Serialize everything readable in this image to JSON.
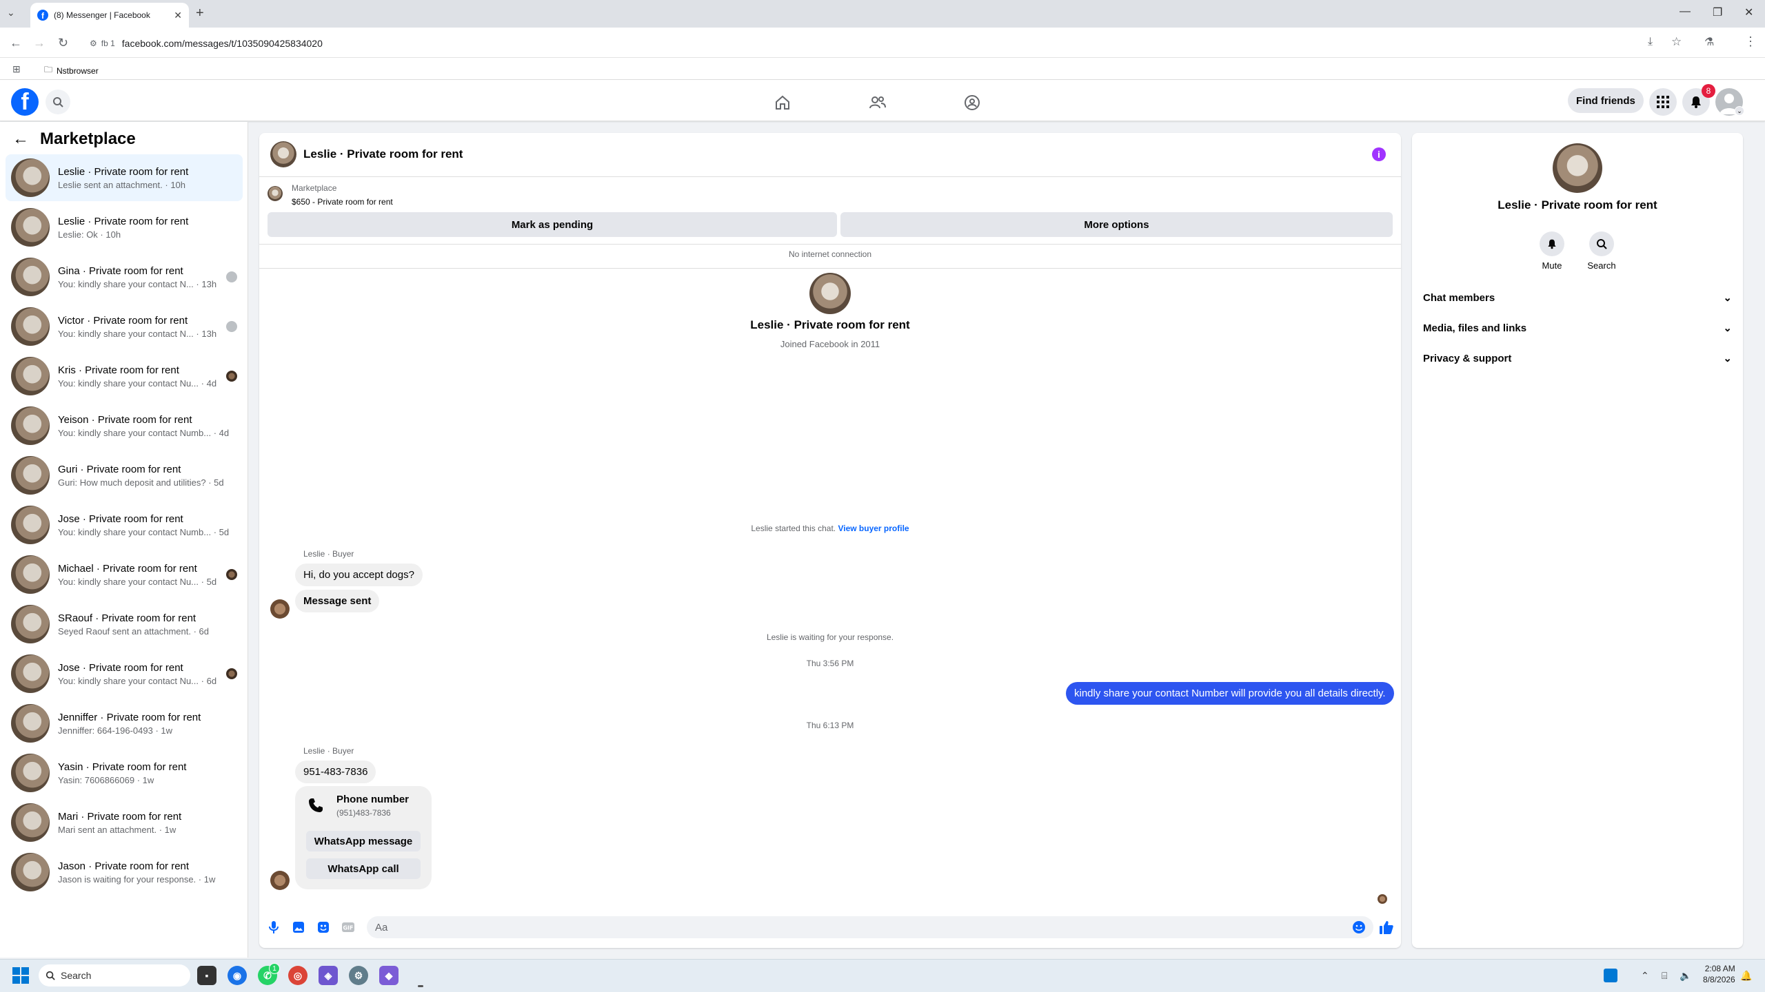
{
  "browser": {
    "tab_title": "(8) Messenger | Facebook",
    "url": "facebook.com/messages/t/1035090425834020",
    "site_chip": "fb 1",
    "bookmark_folder": "Nstbrowser"
  },
  "fb_header": {
    "find_friends": "Find friends",
    "notif_count": "8"
  },
  "sidebar": {
    "title": "Marketplace",
    "conversations": [
      {
        "name": "Leslie · Private room for rent",
        "preview": "Leslie sent an attachment. · 10h",
        "time": ""
      },
      {
        "name": "Leslie · Private room for rent",
        "preview": "Leslie: Ok · 10h",
        "time": ""
      },
      {
        "name": "Gina · Private room for rent",
        "preview": "You: kindly share your contact N...",
        "time": "· 13h"
      },
      {
        "name": "Victor · Private room for rent",
        "preview": "You: kindly share your contact N...",
        "time": "· 13h"
      },
      {
        "name": "Kris · Private room for rent",
        "preview": "You: kindly share your contact Nu...",
        "time": "· 4d"
      },
      {
        "name": "Yeison · Private room for rent",
        "preview": "You: kindly share your contact Numb...",
        "time": "· 4d"
      },
      {
        "name": "Guri · Private room for rent",
        "preview": "Guri: How much deposit and utilities?",
        "time": "· 5d"
      },
      {
        "name": "Jose · Private room for rent",
        "preview": "You: kindly share your contact Numb...",
        "time": "· 5d"
      },
      {
        "name": "Michael · Private room for rent",
        "preview": "You: kindly share your contact Nu...",
        "time": "· 5d"
      },
      {
        "name": "SRaouf · Private room for rent",
        "preview": "Seyed Raouf sent an attachment.",
        "time": "· 6d"
      },
      {
        "name": "Jose · Private room for rent",
        "preview": "You: kindly share your contact Nu...",
        "time": "· 6d"
      },
      {
        "name": "Jenniffer · Private room for rent",
        "preview": "Jenniffer: 664-196-0493",
        "time": "· 1w"
      },
      {
        "name": "Yasin · Private room for rent",
        "preview": "Yasin: 7606866069",
        "time": "· 1w"
      },
      {
        "name": "Mari · Private room for rent",
        "preview": "Mari sent an attachment.",
        "time": "· 1w"
      },
      {
        "name": "Jason · Private room for rent",
        "preview": "Jason is waiting for your response.",
        "time": "· 1w"
      }
    ]
  },
  "chat": {
    "title": "Leslie · Private room for rent",
    "marketplace_label": "Marketplace",
    "listing": "$650 - Private room for rent",
    "mark_pending": "Mark as pending",
    "more_options": "More options",
    "no_internet": "No internet connection",
    "profile_name": "Leslie · Private room for rent",
    "profile_sub": "Joined Facebook in 2011",
    "started_text": "Leslie started this chat.",
    "view_buyer": "View buyer profile",
    "sender_label": "Leslie · Buyer",
    "msg1": "Hi, do you accept dogs?",
    "msg2": "Message sent",
    "waiting": "Leslie is waiting for your response.",
    "time1": "Thu 3:56 PM",
    "outgoing": "kindly share your contact Number will provide you all details directly.",
    "time2": "Thu 6:13 PM",
    "sender_label2": "Leslie · Buyer",
    "phone_msg": "951-483-7836",
    "card_title": "Phone number",
    "card_number": "(951)483-7836",
    "wa_message": "WhatsApp message",
    "wa_call": "WhatsApp call",
    "composer_placeholder": "Aa"
  },
  "right_panel": {
    "name": "Leslie · Private room for rent",
    "mute": "Mute",
    "search": "Search",
    "sections": [
      "Chat members",
      "Media, files and links",
      "Privacy & support"
    ]
  },
  "taskbar": {
    "search": "Search",
    "time": "2:08 AM",
    "date": "8/8/2026",
    "whatsapp_badge": "1"
  },
  "colors": {
    "accent": "#0866ff",
    "outgoing_bubble": "#2d55f0",
    "info_purple": "#a033ff"
  }
}
